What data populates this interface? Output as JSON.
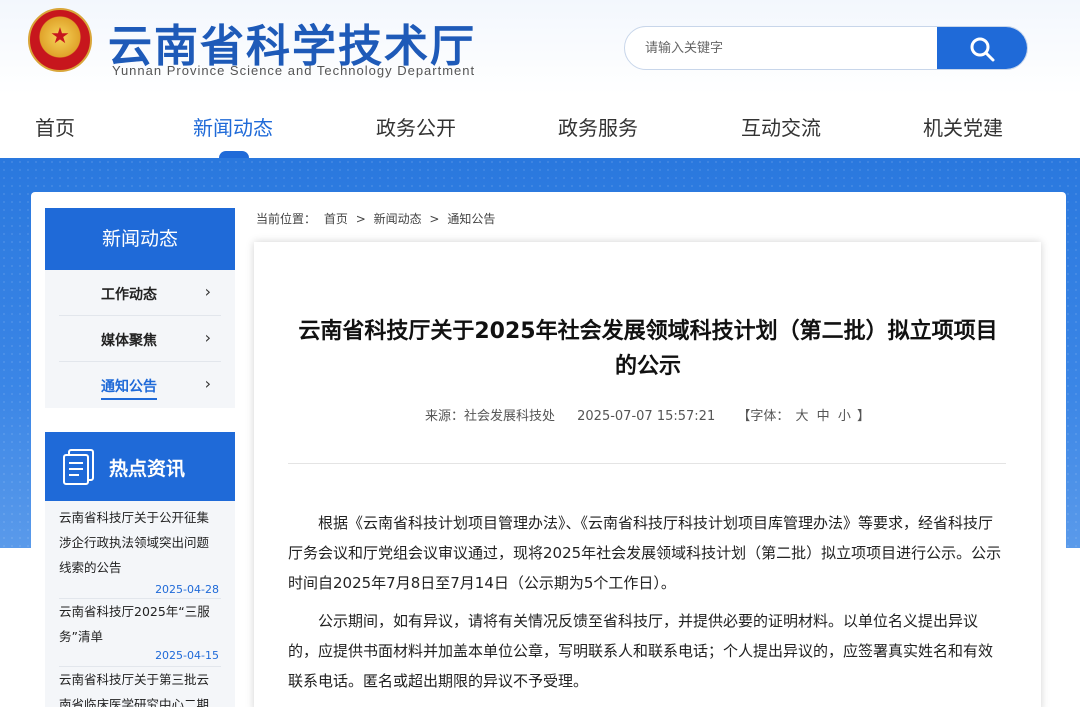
{
  "site": {
    "title": "云南省科学技术厅",
    "subtitle": "Yunnan Province Science and Technology Department"
  },
  "search": {
    "placeholder": "请输入关键字",
    "icon": "search-icon"
  },
  "nav": [
    {
      "label": "首页",
      "active": false
    },
    {
      "label": "新闻动态",
      "active": true
    },
    {
      "label": "政务公开",
      "active": false
    },
    {
      "label": "政务服务",
      "active": false
    },
    {
      "label": "互动交流",
      "active": false
    },
    {
      "label": "机关党建",
      "active": false
    }
  ],
  "sidebar": {
    "title": "新闻动态",
    "items": [
      {
        "label": "工作动态"
      },
      {
        "label": "媒体聚焦"
      },
      {
        "label": "通知公告",
        "active": true
      }
    ]
  },
  "hot": {
    "title": "热点资讯",
    "items": [
      {
        "title": "云南省科技厅关于公开征集涉企行政执法领域突出问题线索的公告",
        "date": "2025-04-28"
      },
      {
        "title": "云南省科技厅2025年“三服务”清单",
        "date": "2025-04-15"
      },
      {
        "title": "云南省科技厅关于第三批云南省临床医学研究中心二期",
        "date": ""
      }
    ]
  },
  "breadcrumb": {
    "prefix": "当前位置：",
    "items": [
      "首页",
      "新闻动态",
      "通知公告"
    ],
    "sep": ">"
  },
  "article": {
    "title": "云南省科技厅关于2025年社会发展领域科技计划（第二批）拟立项项目的公示",
    "source": "来源：社会发展科技处",
    "datetime": "2025-07-07 15:57:21",
    "font_label": "【字体：",
    "font_sizes": [
      "大",
      "中",
      "小"
    ],
    "font_close": "】",
    "paragraphs": [
      "根据《云南省科技计划项目管理办法》、《云南省科技厅科技计划项目库管理办法》等要求，经省科技厅厅务会议和厅党组会议审议通过，现将2025年社会发展领域科技计划（第二批）拟立项项目进行公示。公示时间自2025年7月8日至7月14日（公示期为5个工作日）。",
      "公示期间，如有异议，请将有关情况反馈至省科技厅，并提供必要的证明材料。以单位名义提出异议的，应提供书面材料并加盖本单位公章，写明联系人和联系电话；个人提出异议的，应签署真实姓名和有效联系电话。匿名或超出期限的异议不予受理。"
    ]
  },
  "colors": {
    "primary": "#1f6ad8",
    "band": "#2a78de",
    "accent_red": "#c7161d"
  }
}
